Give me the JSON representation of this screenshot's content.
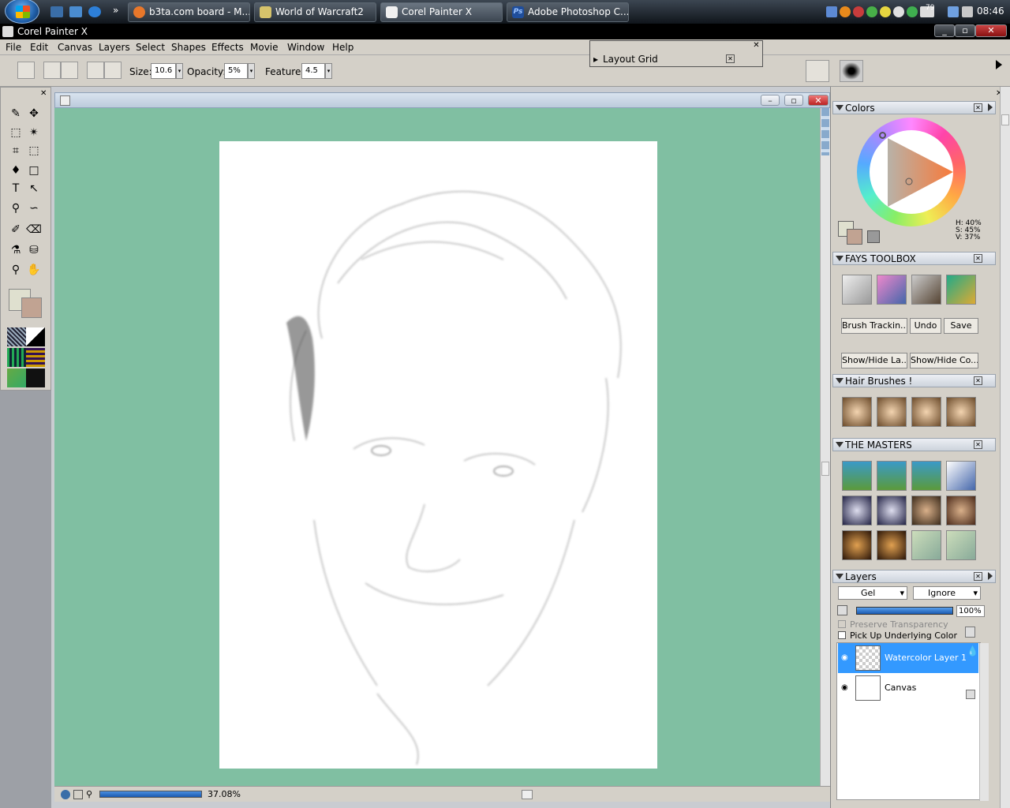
{
  "taskbar": {
    "tasks": [
      {
        "label": "b3ta.com board - M...",
        "color": "#e8772a"
      },
      {
        "label": "World of Warcraft2",
        "color": "#d6c36b"
      },
      {
        "label": "Corel Painter X",
        "color": "#f0f0f0"
      },
      {
        "label": "Adobe Photoshop C...",
        "color": "#1f4e9c",
        "icon_text": "Ps"
      }
    ],
    "overflow": "»",
    "battery": "79",
    "clock": "08:46"
  },
  "app": {
    "title": "Corel Painter X"
  },
  "menu": [
    "File",
    "Edit",
    "Canvas",
    "Layers",
    "Select",
    "Shapes",
    "Effects",
    "Movie",
    "Window",
    "Help"
  ],
  "propbar": {
    "size_label": "Size:",
    "size_value": "10.6",
    "opacity_label": "Opacity:",
    "opacity_value": "5%",
    "feature_label": "Feature:",
    "feature_value": "4.5"
  },
  "layout_grid": {
    "title": "Layout Grid"
  },
  "status": {
    "zoom": "37.08%"
  },
  "colors_panel": {
    "title": "Colors",
    "h": "H: 40%",
    "s": "S: 45%",
    "v": "V: 37%",
    "main_color": "#dfe0cf",
    "additional_color": "#c1a392"
  },
  "fays_toolbox": {
    "title": "FAYS TOOLBOX",
    "buttons": [
      "Brush Trackin...",
      "Undo",
      "Save",
      "Show/Hide La...",
      "Show/Hide Co..."
    ]
  },
  "hair_brushes": {
    "title": "Hair Brushes !"
  },
  "masters": {
    "title": "THE MASTERS"
  },
  "layers_panel": {
    "title": "Layers",
    "composite_method": "Gel",
    "depth": "Ignore",
    "opacity": "100%",
    "preserve_transparency": "Preserve Transparency",
    "pick_up": "Pick Up Underlying Color",
    "layers": [
      "Watercolor Layer 1",
      "Canvas"
    ]
  }
}
